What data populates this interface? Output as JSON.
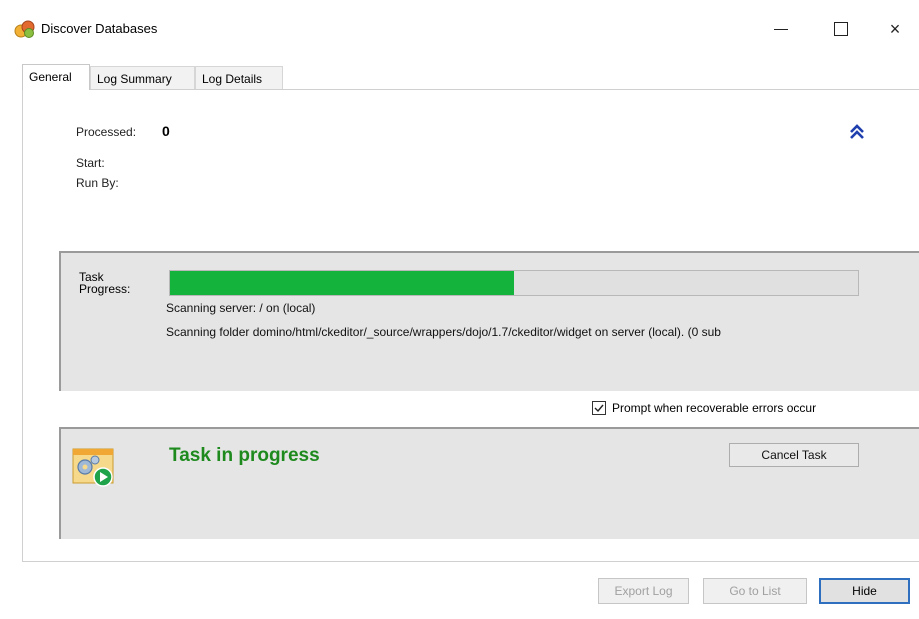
{
  "window": {
    "title": "Discover Databases",
    "icon": "app-icon",
    "controls": {
      "minimize": "minimize-icon",
      "maximize": "maximize-icon",
      "close": "×"
    }
  },
  "tabs": [
    {
      "label": "General",
      "active": true
    },
    {
      "label": "Log Summary",
      "active": false
    },
    {
      "label": "Log Details",
      "active": false
    }
  ],
  "general": {
    "processed_label": "Processed:",
    "processed_value": "0",
    "start_label": "Start:",
    "run_by_label": "Run By:",
    "collapse_icon": "double-chevron-up-icon"
  },
  "progress": {
    "label": "Task\nProgress:",
    "percent": 50,
    "line1": "Scanning server: / on (local)",
    "line2": "Scanning folder domino/html/ckeditor/_source/wrappers/dojo/1.7/ckeditor/widget on server (local). (0 sub",
    "fill_color": "#14b43c"
  },
  "prompt_checkbox": {
    "label": "Prompt when recoverable errors occur",
    "checked": true
  },
  "status": {
    "text": "Task in progress",
    "color": "#1e8a1e",
    "cancel_label": "Cancel Task"
  },
  "footer": {
    "export_label": "Export Log",
    "goto_label": "Go to List",
    "hide_label": "Hide"
  }
}
